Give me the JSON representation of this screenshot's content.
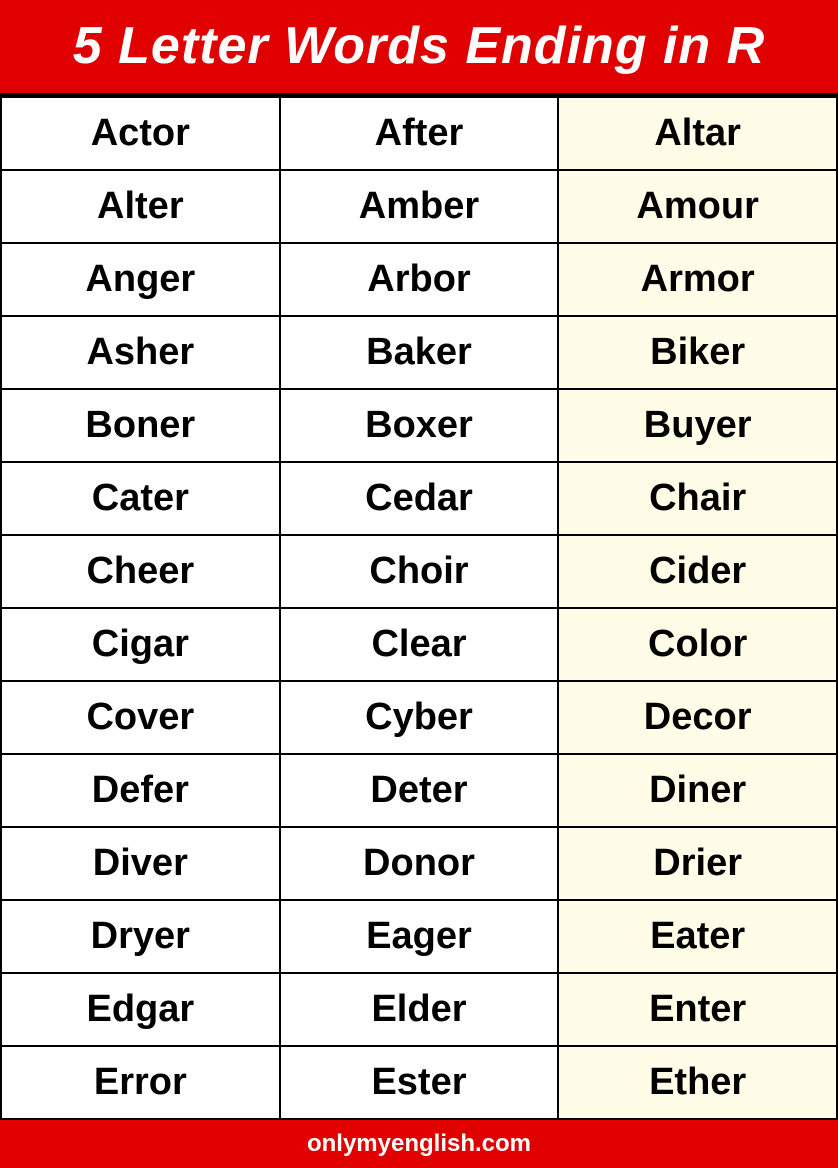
{
  "header": {
    "title": "5 Letter Words Ending in R"
  },
  "footer": {
    "website": "onlymyenglish.com"
  },
  "words": [
    [
      "Actor",
      "After",
      "Altar"
    ],
    [
      "Alter",
      "Amber",
      "Amour"
    ],
    [
      "Anger",
      "Arbor",
      "Armor"
    ],
    [
      "Asher",
      "Baker",
      "Biker"
    ],
    [
      "Boner",
      "Boxer",
      "Buyer"
    ],
    [
      "Cater",
      "Cedar",
      "Chair"
    ],
    [
      "Cheer",
      "Choir",
      "Cider"
    ],
    [
      "Cigar",
      "Clear",
      "Color"
    ],
    [
      "Cover",
      "Cyber",
      "Decor"
    ],
    [
      "Defer",
      "Deter",
      "Diner"
    ],
    [
      "Diver",
      "Donor",
      "Drier"
    ],
    [
      "Dryer",
      "Eager",
      "Eater"
    ],
    [
      "Edgar",
      "Elder",
      "Enter"
    ],
    [
      "Error",
      "Ester",
      "Ether"
    ]
  ]
}
